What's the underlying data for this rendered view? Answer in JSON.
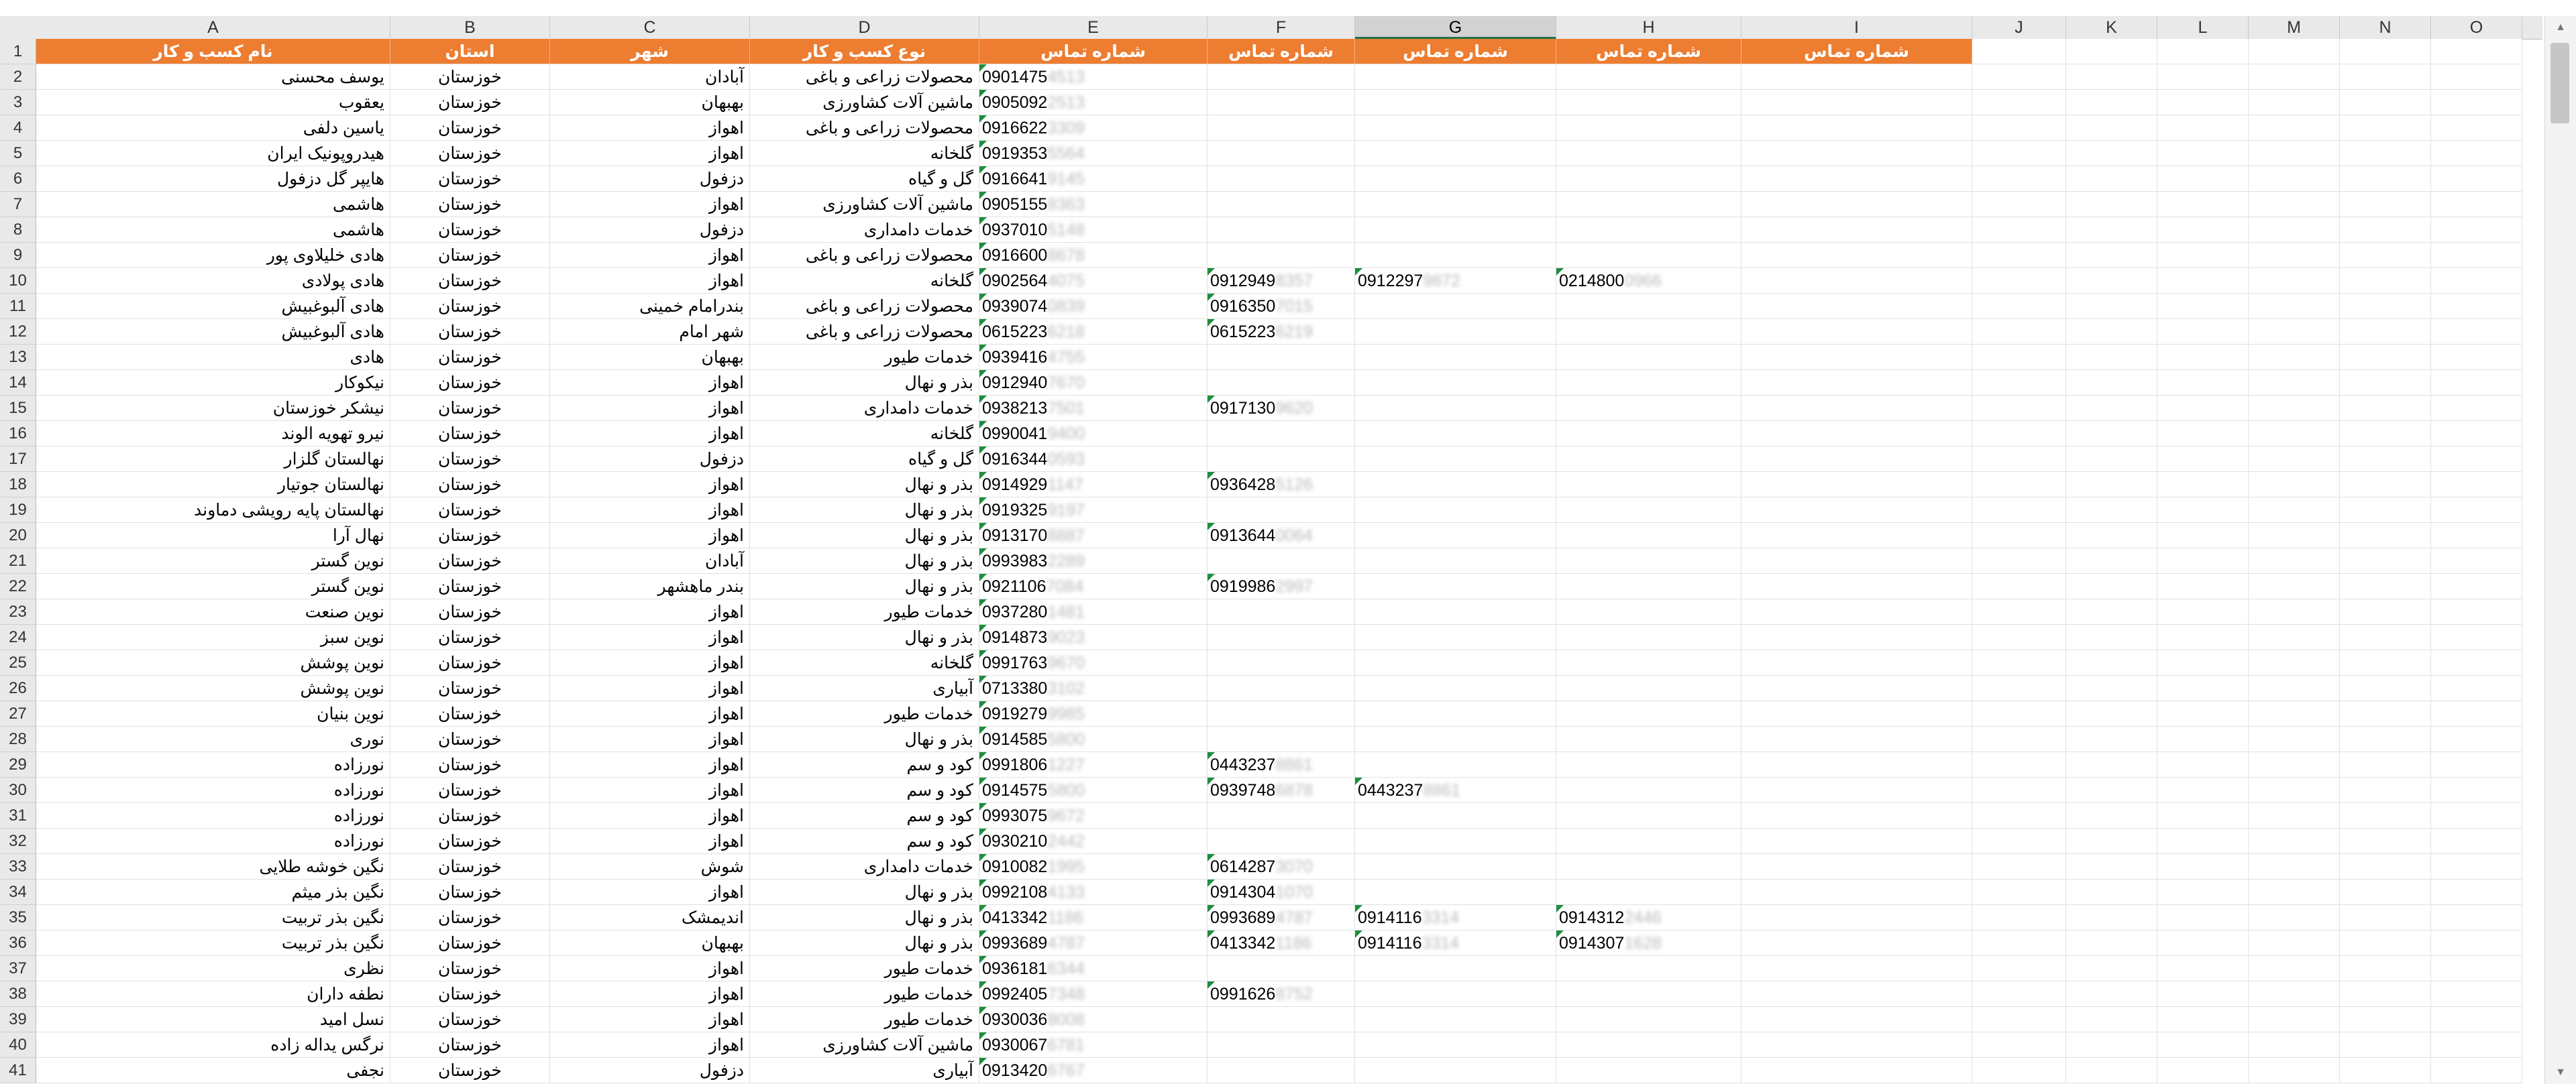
{
  "columns": [
    "A",
    "B",
    "C",
    "D",
    "E",
    "F",
    "G",
    "H",
    "I",
    "J",
    "K",
    "L",
    "M",
    "N",
    "O"
  ],
  "selected_column": "G",
  "header_row": {
    "business_name": "نام کسب و کار",
    "province": "استان",
    "city": "شهر",
    "business_type": "نوع کسب و کار",
    "phone1": "شماره تماس",
    "phone2": "شماره تماس",
    "phone3": "شماره تماس",
    "phone4": "شماره تماس",
    "phone5": "شماره تماس"
  },
  "rows": [
    {
      "n": "2",
      "name": "یوسف محسنی",
      "prov": "خوزستان",
      "city": "آبادان",
      "type": "محصولات زراعی و باغی",
      "p1": "0901475",
      "p1b": "4513"
    },
    {
      "n": "3",
      "name": "یعقوب",
      "prov": "خوزستان",
      "city": "بهبهان",
      "type": "ماشین آلات کشاورزی",
      "p1": "0905092",
      "p1b": "2513"
    },
    {
      "n": "4",
      "name": "یاسین دلفی",
      "prov": "خوزستان",
      "city": "اهواز",
      "type": "محصولات زراعی و باغی",
      "p1": "0916622",
      "p1b": "3309"
    },
    {
      "n": "5",
      "name": "هیدروپونیک ایران",
      "prov": "خوزستان",
      "city": "اهواز",
      "type": "گلخانه",
      "p1": "0919353",
      "p1b": "5564"
    },
    {
      "n": "6",
      "name": "هایپر گل دزفول",
      "prov": "خوزستان",
      "city": "دزفول",
      "type": "گل و گیاه",
      "p1": "0916641",
      "p1b": "9145"
    },
    {
      "n": "7",
      "name": "هاشمی",
      "prov": "خوزستان",
      "city": "اهواز",
      "type": "ماشین آلات کشاورزی",
      "p1": "0905155",
      "p1b": "8363"
    },
    {
      "n": "8",
      "name": "هاشمی",
      "prov": "خوزستان",
      "city": "دزفول",
      "type": "خدمات دامداری",
      "p1": "0937010",
      "p1b": "5148"
    },
    {
      "n": "9",
      "name": "هادی خلیلاوی پور",
      "prov": "خوزستان",
      "city": "اهواز",
      "type": "محصولات زراعی و باغی",
      "p1": "0916600",
      "p1b": "8678"
    },
    {
      "n": "10",
      "name": "هادی پولادی",
      "prov": "خوزستان",
      "city": "اهواز",
      "type": "گلخانه",
      "p1": "0902564",
      "p1b": "4075",
      "p2": "0912949",
      "p2b": "8357",
      "p3": "0912297",
      "p3b": "9872",
      "p4": "0214800",
      "p4b": "0966"
    },
    {
      "n": "11",
      "name": "هادی آلبوغبیش",
      "prov": "خوزستان",
      "city": "بندرامام خمینی",
      "type": "محصولات زراعی و باغی",
      "p1": "0939074",
      "p1b": "0839",
      "p2": "0916350",
      "p2b": "7015"
    },
    {
      "n": "12",
      "name": "هادی آلبوغبیش",
      "prov": "خوزستان",
      "city": "شهر امام",
      "type": "محصولات زراعی و باغی",
      "p1": "0615223",
      "p1b": "6218",
      "p2": "0615223",
      "p2b": "6219"
    },
    {
      "n": "13",
      "name": "هادی",
      "prov": "خوزستان",
      "city": "بهبهان",
      "type": "خدمات طیور",
      "p1": "0939416",
      "p1b": "4755"
    },
    {
      "n": "14",
      "name": "نیکوکار",
      "prov": "خوزستان",
      "city": "اهواز",
      "type": "بذر و نهال",
      "p1": "0912940",
      "p1b": "7670"
    },
    {
      "n": "15",
      "name": "نیشکر خوزستان",
      "prov": "خوزستان",
      "city": "اهواز",
      "type": "خدمات دامداری",
      "p1": "0938213",
      "p1b": "7501",
      "p2": "0917130",
      "p2b": "9620"
    },
    {
      "n": "16",
      "name": "نیرو تهویه الوند",
      "prov": "خوزستان",
      "city": "اهواز",
      "type": "گلخانه",
      "p1": "0990041",
      "p1b": "9400"
    },
    {
      "n": "17",
      "name": "نهالستان گلزار",
      "prov": "خوزستان",
      "city": "دزفول",
      "type": "گل و گیاه",
      "p1": "0916344",
      "p1b": "0593"
    },
    {
      "n": "18",
      "name": "نهالستان جوتیار",
      "prov": "خوزستان",
      "city": "اهواز",
      "type": "بذر و نهال",
      "p1": "0914929",
      "p1b": "1147",
      "p2": "0936428",
      "p2b": "5126"
    },
    {
      "n": "19",
      "name": "نهالستان پایه رویشی دماوند",
      "prov": "خوزستان",
      "city": "اهواز",
      "type": "بذر و نهال",
      "p1": "0919325",
      "p1b": "9197"
    },
    {
      "n": "20",
      "name": "نهال آرا",
      "prov": "خوزستان",
      "city": "اهواز",
      "type": "بذر و نهال",
      "p1": "0913170",
      "p1b": "8887",
      "p2": "0913644",
      "p2b": "0064"
    },
    {
      "n": "21",
      "name": "نوین گستر",
      "prov": "خوزستان",
      "city": "آبادان",
      "type": "بذر و نهال",
      "p1": "0993983",
      "p1b": "2289"
    },
    {
      "n": "22",
      "name": "نوین گستر",
      "prov": "خوزستان",
      "city": "بندر ماهشهر",
      "type": "بذر و نهال",
      "p1": "0921106",
      "p1b": "7084",
      "p2": "0919986",
      "p2b": "2997"
    },
    {
      "n": "23",
      "name": "نوین صنعت",
      "prov": "خوزستان",
      "city": "اهواز",
      "type": "خدمات طیور",
      "p1": "0937280",
      "p1b": "1481"
    },
    {
      "n": "24",
      "name": "نوین سبز",
      "prov": "خوزستان",
      "city": "اهواز",
      "type": "بذر و نهال",
      "p1": "0914873",
      "p1b": "9023"
    },
    {
      "n": "25",
      "name": "نوین پوشش",
      "prov": "خوزستان",
      "city": "اهواز",
      "type": "گلخانه",
      "p1": "0991763",
      "p1b": "9670"
    },
    {
      "n": "26",
      "name": "نوین پوشش",
      "prov": "خوزستان",
      "city": "اهواز",
      "type": "آبیاری",
      "p1": "0713380",
      "p1b": "3102"
    },
    {
      "n": "27",
      "name": "نوین بنیان",
      "prov": "خوزستان",
      "city": "اهواز",
      "type": "خدمات طیور",
      "p1": "0919279",
      "p1b": "9985"
    },
    {
      "n": "28",
      "name": "نوری",
      "prov": "خوزستان",
      "city": "اهواز",
      "type": "بذر و نهال",
      "p1": "0914585",
      "p1b": "5800"
    },
    {
      "n": "29",
      "name": "نورزاده",
      "prov": "خوزستان",
      "city": "اهواز",
      "type": "کود و سم",
      "p1": "0991806",
      "p1b": "1227",
      "p2": "0443237",
      "p2b": "8861"
    },
    {
      "n": "30",
      "name": "نورزاده",
      "prov": "خوزستان",
      "city": "اهواز",
      "type": "کود و سم",
      "p1": "0914575",
      "p1b": "5800",
      "p2": "0939748",
      "p2b": "6878",
      "p3": "0443237",
      "p3b": "8861"
    },
    {
      "n": "31",
      "name": "نورزاده",
      "prov": "خوزستان",
      "city": "اهواز",
      "type": "کود و سم",
      "p1": "0993075",
      "p1b": "9672"
    },
    {
      "n": "32",
      "name": "نورزاده",
      "prov": "خوزستان",
      "city": "اهواز",
      "type": "کود و سم",
      "p1": "0930210",
      "p1b": "2442"
    },
    {
      "n": "33",
      "name": "نگین خوشه طلایی",
      "prov": "خوزستان",
      "city": "شوش",
      "type": "خدمات دامداری",
      "p1": "0910082",
      "p1b": "1995",
      "p2": "0614287",
      "p2b": "3070"
    },
    {
      "n": "34",
      "name": "نگین بذر میثم",
      "prov": "خوزستان",
      "city": "اهواز",
      "type": "بذر و نهال",
      "p1": "0992108",
      "p1b": "4133",
      "p2": "0914304",
      "p2b": "1070"
    },
    {
      "n": "35",
      "name": "نگین بذر تربیت",
      "prov": "خوزستان",
      "city": "اندیمشک",
      "type": "بذر و نهال",
      "p1": "0413342",
      "p1b": "1186",
      "p2": "0993689",
      "p2b": "4787",
      "p3": "0914116",
      "p3b": "3314",
      "p4": "0914312",
      "p4b": "2446"
    },
    {
      "n": "36",
      "name": "نگین بذر تربیت",
      "prov": "خوزستان",
      "city": "بهبهان",
      "type": "بذر و نهال",
      "p1": "0993689",
      "p1b": "4787",
      "p2": "0413342",
      "p2b": "1186",
      "p3": "0914116",
      "p3b": "3314",
      "p4": "0914307",
      "p4b": "1628"
    },
    {
      "n": "37",
      "name": "نظری",
      "prov": "خوزستان",
      "city": "اهواز",
      "type": "خدمات طیور",
      "p1": "0936181",
      "p1b": "6344"
    },
    {
      "n": "38",
      "name": "نطفه داران",
      "prov": "خوزستان",
      "city": "اهواز",
      "type": "خدمات طیور",
      "p1": "0992405",
      "p1b": "7348",
      "p2": "0991626",
      "p2b": "8752"
    },
    {
      "n": "39",
      "name": "نسل امید",
      "prov": "خوزستان",
      "city": "اهواز",
      "type": "خدمات طیور",
      "p1": "0930036",
      "p1b": "8008"
    },
    {
      "n": "40",
      "name": "نرگس یداله زاده",
      "prov": "خوزستان",
      "city": "اهواز",
      "type": "ماشین آلات کشاورزی",
      "p1": "0930067",
      "p1b": "6781"
    },
    {
      "n": "41",
      "name": "نجفی",
      "prov": "خوزستان",
      "city": "دزفول",
      "type": "آبیاری",
      "p1": "0913420",
      "p1b": "6767"
    }
  ]
}
